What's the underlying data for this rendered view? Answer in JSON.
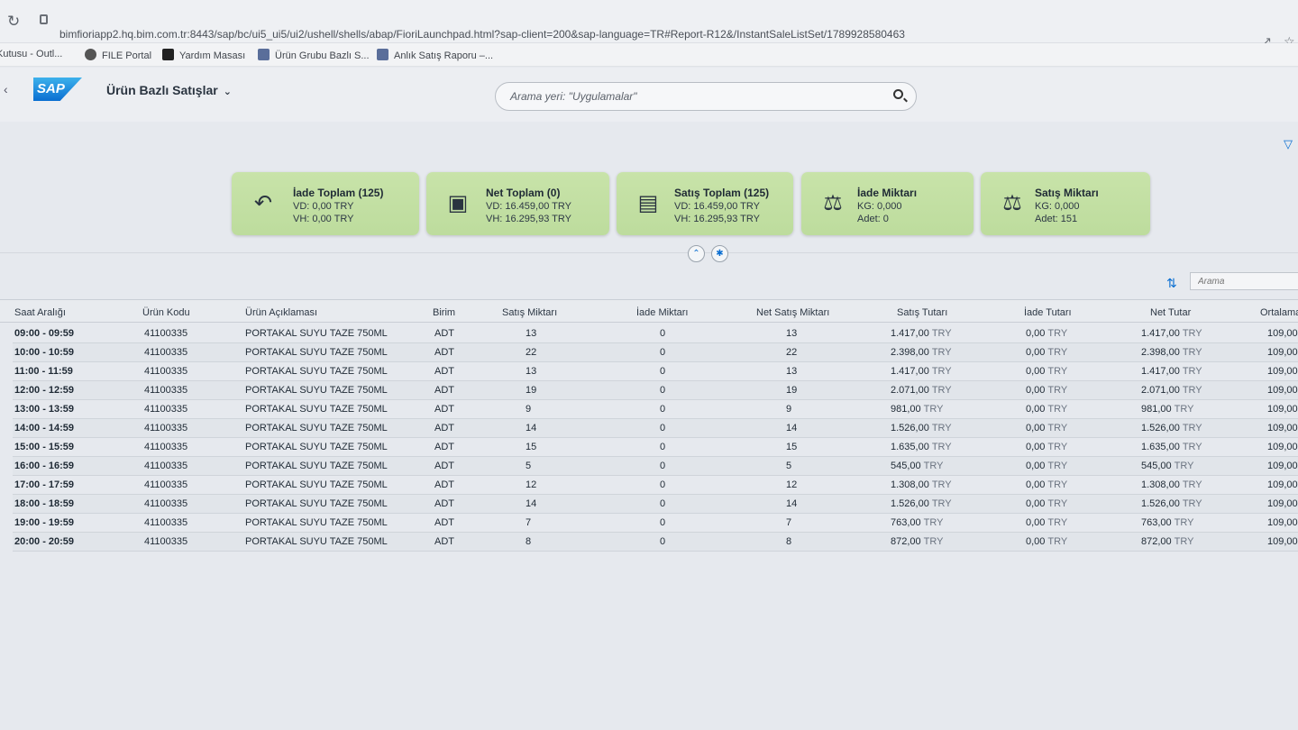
{
  "browser": {
    "url": "bimfioriapp2.hq.bim.com.tr:8443/sap/bc/ui5_ui5/ui2/ushell/shells/abap/FioriLaunchpad.html?sap-client=200&sap-language=TR#Report-R12&/InstantSaleListSet/1789928580463",
    "bookmarks": [
      "Kutusu - Outl...",
      "FILE Portal",
      "Yardım Masası",
      "Ürün Grubu Bazlı S...",
      "Anlık Satış Raporu –..."
    ]
  },
  "shell": {
    "logo": "SAP",
    "title": "Ürün Bazlı Satışlar",
    "search_placeholder": "Arama yeri: \"Uygulamalar\""
  },
  "tiles": [
    {
      "icon": "undo-icon",
      "title": "İade Toplam (125)",
      "line1": "VD: 0,00 TRY",
      "line2": "VH: 0,00 TRY"
    },
    {
      "icon": "wallet-icon",
      "title": "Net Toplam (0)",
      "line1": "VD: 16.459,00 TRY",
      "line2": "VH: 16.295,93 TRY"
    },
    {
      "icon": "money-icon",
      "title": "Satış Toplam (125)",
      "line1": "VD: 16.459,00 TRY",
      "line2": "VH: 16.295,93 TRY"
    },
    {
      "icon": "scale-icon",
      "title": "İade Miktarı",
      "line1": "KG: 0,000",
      "line2": "Adet: 0"
    },
    {
      "icon": "scale-icon",
      "title": "Satış Miktarı",
      "line1": "KG: 0,000",
      "line2": "Adet: 151"
    }
  ],
  "table": {
    "search_placeholder": "Arama",
    "columns": [
      "Saat Aralığı",
      "Ürün Kodu",
      "Ürün Açıklaması",
      "Birim",
      "Satış Miktarı",
      "İade Miktarı",
      "Net Satış Miktarı",
      "Satış Tutarı",
      "İade Tutarı",
      "Net Tutar",
      "Ortalama"
    ],
    "currency": "TRY",
    "rows": [
      [
        "09:00 - 09:59",
        "41100335",
        "PORTAKAL SUYU TAZE 750ML",
        "ADT",
        "13",
        "0",
        "13",
        "1.417,00",
        "0,00",
        "1.417,00",
        "109,00"
      ],
      [
        "10:00 - 10:59",
        "41100335",
        "PORTAKAL SUYU TAZE 750ML",
        "ADT",
        "22",
        "0",
        "22",
        "2.398,00",
        "0,00",
        "2.398,00",
        "109,00"
      ],
      [
        "11:00 - 11:59",
        "41100335",
        "PORTAKAL SUYU TAZE 750ML",
        "ADT",
        "13",
        "0",
        "13",
        "1.417,00",
        "0,00",
        "1.417,00",
        "109,00"
      ],
      [
        "12:00 - 12:59",
        "41100335",
        "PORTAKAL SUYU TAZE 750ML",
        "ADT",
        "19",
        "0",
        "19",
        "2.071,00",
        "0,00",
        "2.071,00",
        "109,00"
      ],
      [
        "13:00 - 13:59",
        "41100335",
        "PORTAKAL SUYU TAZE 750ML",
        "ADT",
        "9",
        "0",
        "9",
        "981,00",
        "0,00",
        "981,00",
        "109,00"
      ],
      [
        "14:00 - 14:59",
        "41100335",
        "PORTAKAL SUYU TAZE 750ML",
        "ADT",
        "14",
        "0",
        "14",
        "1.526,00",
        "0,00",
        "1.526,00",
        "109,00"
      ],
      [
        "15:00 - 15:59",
        "41100335",
        "PORTAKAL SUYU TAZE 750ML",
        "ADT",
        "15",
        "0",
        "15",
        "1.635,00",
        "0,00",
        "1.635,00",
        "109,00"
      ],
      [
        "16:00 - 16:59",
        "41100335",
        "PORTAKAL SUYU TAZE 750ML",
        "ADT",
        "5",
        "0",
        "5",
        "545,00",
        "0,00",
        "545,00",
        "109,00"
      ],
      [
        "17:00 - 17:59",
        "41100335",
        "PORTAKAL SUYU TAZE 750ML",
        "ADT",
        "12",
        "0",
        "12",
        "1.308,00",
        "0,00",
        "1.308,00",
        "109,00"
      ],
      [
        "18:00 - 18:59",
        "41100335",
        "PORTAKAL SUYU TAZE 750ML",
        "ADT",
        "14",
        "0",
        "14",
        "1.526,00",
        "0,00",
        "1.526,00",
        "109,00"
      ],
      [
        "19:00 - 19:59",
        "41100335",
        "PORTAKAL SUYU TAZE 750ML",
        "ADT",
        "7",
        "0",
        "7",
        "763,00",
        "0,00",
        "763,00",
        "109,00"
      ],
      [
        "20:00 - 20:59",
        "41100335",
        "PORTAKAL SUYU TAZE 750ML",
        "ADT",
        "8",
        "0",
        "8",
        "872,00",
        "0,00",
        "872,00",
        "109,00"
      ]
    ]
  }
}
